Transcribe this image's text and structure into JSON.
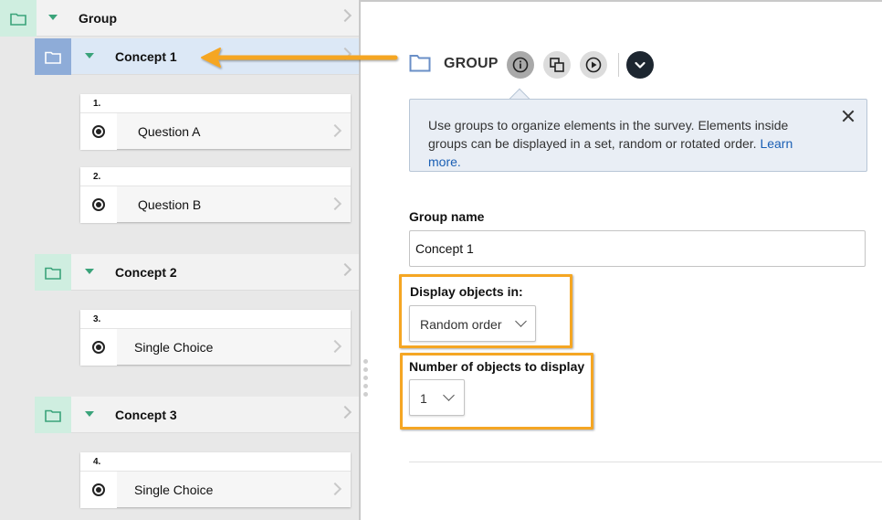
{
  "sidebar": {
    "group": {
      "label": "Group"
    },
    "concepts": [
      {
        "label": "Concept 1"
      },
      {
        "label": "Concept 2"
      },
      {
        "label": "Concept 3"
      }
    ],
    "questions": [
      {
        "number": "1.",
        "label": "Question A"
      },
      {
        "number": "2.",
        "label": "Question B"
      },
      {
        "number": "3.",
        "label": "Single Choice"
      },
      {
        "number": "4.",
        "label": "Single Choice"
      }
    ]
  },
  "header": {
    "title": "GROUP"
  },
  "info_box": {
    "message": "Use groups to organize elements in the survey. Elements inside groups can be displayed in a set, random or rotated order.",
    "link": "Learn more."
  },
  "form": {
    "group_name_label": "Group name",
    "group_name_value": "Concept 1",
    "display_label": "Display objects in:",
    "display_value": "Random order",
    "count_label": "Number of objects to display",
    "count_value": "1"
  },
  "colors": {
    "highlight": "#f5a623",
    "selected_row": "#dce8f6",
    "folder_green": "#cfeee0",
    "link_blue": "#1a5fb4"
  }
}
